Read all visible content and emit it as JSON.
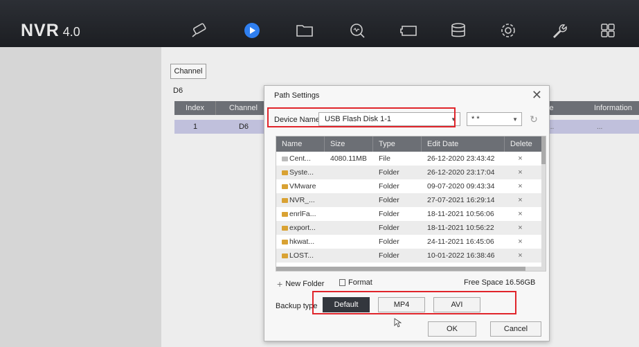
{
  "app": {
    "logo_main": "NVR",
    "logo_version": "4.0"
  },
  "nav_icons": [
    "camera-icon",
    "play-icon",
    "folder-icon",
    "search-icon",
    "event-icon",
    "storage-icon",
    "settings-icon",
    "wrench-icon",
    "grid-icon"
  ],
  "colors": {
    "topbar": "#1c1e22",
    "accent": "#2f7ff0",
    "highlight": "#e0242a",
    "table_header": "#6c6f75",
    "selected_row": "#c0c0dc"
  },
  "background": {
    "channel_button": "Channel",
    "d6_label": "D6",
    "table_headers": [
      "Index",
      "Channel"
    ],
    "row": [
      "1",
      "D6"
    ],
    "right_headers": [
      "ze",
      "Information"
    ],
    "right_row": [
      "...",
      "..."
    ]
  },
  "dialog": {
    "title": "Path Settings",
    "device_label": "Device Name",
    "device_value": "USB Flash Disk 1-1",
    "format_value": "* *",
    "file_table": {
      "headers": [
        "Name",
        "Size",
        "Type",
        "Edit Date",
        "Delete"
      ],
      "rows": [
        {
          "icon": "file",
          "name": "Cent...",
          "size": "4080.11MB",
          "type": "File",
          "date": "26-12-2020 23:43:42",
          "del": "×"
        },
        {
          "icon": "folder",
          "name": "Syste...",
          "size": "",
          "type": "Folder",
          "date": "26-12-2020 23:17:04",
          "del": "×"
        },
        {
          "icon": "folder",
          "name": "VMware",
          "size": "",
          "type": "Folder",
          "date": "09-07-2020 09:43:34",
          "del": "×"
        },
        {
          "icon": "folder",
          "name": "NVR_...",
          "size": "",
          "type": "Folder",
          "date": "27-07-2021 16:29:14",
          "del": "×"
        },
        {
          "icon": "folder",
          "name": "enrlFa...",
          "size": "",
          "type": "Folder",
          "date": "18-11-2021 10:56:06",
          "del": "×"
        },
        {
          "icon": "folder",
          "name": "export...",
          "size": "",
          "type": "Folder",
          "date": "18-11-2021 10:56:22",
          "del": "×"
        },
        {
          "icon": "folder",
          "name": "hkwat...",
          "size": "",
          "type": "Folder",
          "date": "24-11-2021 16:45:06",
          "del": "×"
        },
        {
          "icon": "folder",
          "name": "LOST...",
          "size": "",
          "type": "Folder",
          "date": "10-01-2022 16:38:46",
          "del": "×"
        }
      ]
    },
    "new_folder": "New Folder",
    "format": "Format",
    "free_space": "Free Space 16.56GB",
    "backup_type_label": "Backup type",
    "backup_types": [
      "Default",
      "MP4",
      "AVI"
    ],
    "backup_selected": "Default",
    "ok": "OK",
    "cancel": "Cancel"
  }
}
